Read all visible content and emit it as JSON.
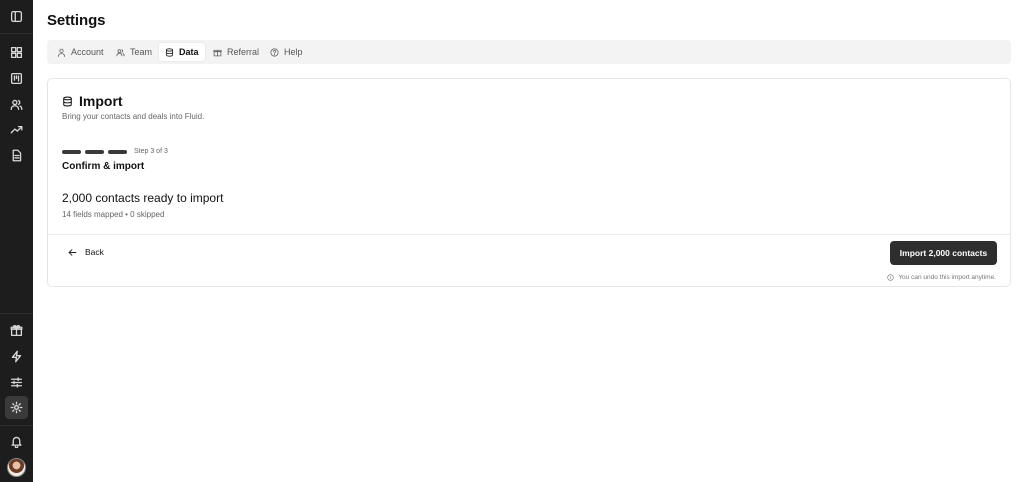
{
  "page": {
    "title": "Settings"
  },
  "tabs": [
    {
      "label": "Account",
      "icon": "user-icon"
    },
    {
      "label": "Team",
      "icon": "users-icon"
    },
    {
      "label": "Data",
      "icon": "database-icon",
      "active": true
    },
    {
      "label": "Referral",
      "icon": "gift-icon"
    },
    {
      "label": "Help",
      "icon": "help-circle-icon"
    }
  ],
  "sidebar": {
    "top_icon": "sidebar-toggle-icon",
    "nav_icons": [
      "dashboard-icon",
      "board-icon",
      "contacts-icon",
      "trending-icon",
      "document-icon"
    ],
    "bottom_icons": [
      "gift-icon",
      "lightning-icon",
      "sliders-icon",
      "gear-icon"
    ],
    "active_icon": "gear-icon",
    "footer_icons": [
      "bell-icon",
      "avatar"
    ]
  },
  "import": {
    "title": "Import",
    "subtitle": "Bring your contacts and deals into Fluid.",
    "step_label": "Step 3 of 3",
    "step_title": "Confirm & import",
    "summary": "2,000 contacts ready to import",
    "summary_detail": "14 fields mapped • 0 skipped",
    "back_label": "Back",
    "import_label": "Import 2,000 contacts",
    "note": "You can undo this import anytime."
  },
  "colors": {
    "sidebar_bg": "#1d1d1d",
    "primary_button": "#2e2e2e",
    "tabs_bg": "#f3f3f3"
  }
}
